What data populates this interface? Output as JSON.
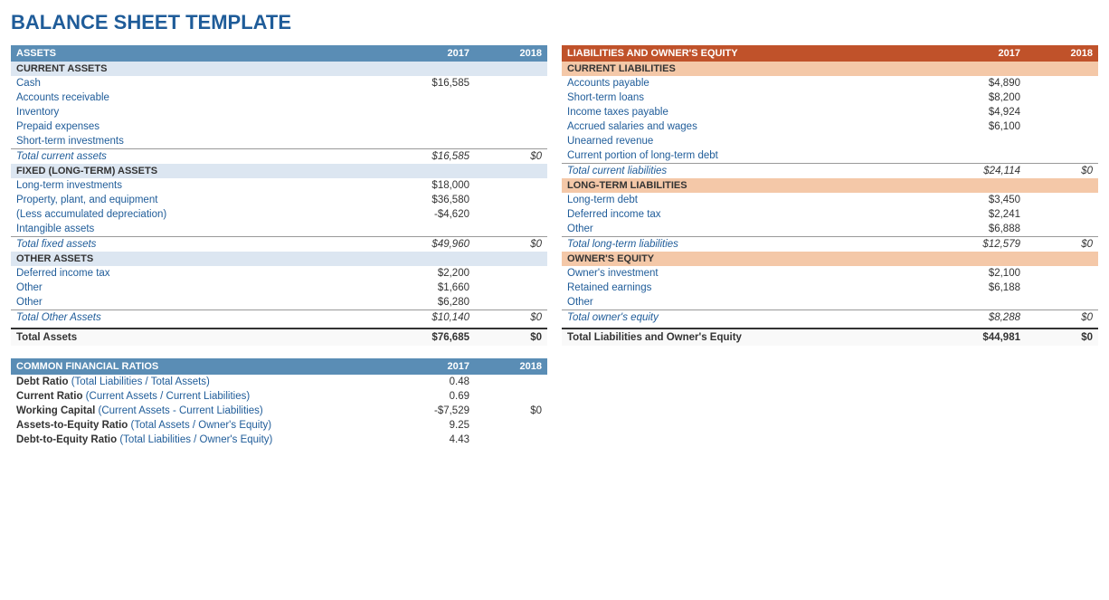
{
  "title": "BALANCE SHEET TEMPLATE",
  "colors": {
    "blue_header": "#5a8db5",
    "orange_header": "#c0522a",
    "blue_sub": "#dce6f1",
    "orange_sub": "#f4c8a8",
    "blue_text": "#1f5c99",
    "title_blue": "#1f5c99"
  },
  "assets": {
    "header": "ASSETS",
    "col2017": "2017",
    "col2018": "2018",
    "current_assets": {
      "label": "CURRENT ASSETS",
      "rows": [
        {
          "label": "Cash",
          "v2017": "$16,585",
          "v2018": ""
        },
        {
          "label": "Accounts receivable",
          "v2017": "",
          "v2018": ""
        },
        {
          "label": "Inventory",
          "v2017": "",
          "v2018": ""
        },
        {
          "label": "Prepaid expenses",
          "v2017": "",
          "v2018": ""
        },
        {
          "label": "Short-term investments",
          "v2017": "",
          "v2018": ""
        }
      ],
      "total_label": "Total current assets",
      "total2017": "$16,585",
      "total2018": "$0"
    },
    "fixed_assets": {
      "label": "FIXED (LONG-TERM) ASSETS",
      "rows": [
        {
          "label": "Long-term investments",
          "v2017": "$18,000",
          "v2018": ""
        },
        {
          "label": "Property, plant, and equipment",
          "v2017": "$36,580",
          "v2018": ""
        },
        {
          "label": "(Less accumulated depreciation)",
          "v2017": "-$4,620",
          "v2018": ""
        },
        {
          "label": "Intangible assets",
          "v2017": "",
          "v2018": ""
        }
      ],
      "total_label": "Total fixed assets",
      "total2017": "$49,960",
      "total2018": "$0"
    },
    "other_assets": {
      "label": "OTHER ASSETS",
      "rows": [
        {
          "label": "Deferred income tax",
          "v2017": "$2,200",
          "v2018": ""
        },
        {
          "label": "Other",
          "v2017": "$1,660",
          "v2018": ""
        },
        {
          "label": "Other",
          "v2017": "$6,280",
          "v2018": ""
        }
      ],
      "total_label": "Total Other Assets",
      "total2017": "$10,140",
      "total2018": "$0"
    },
    "total_label": "Total Assets",
    "total2017": "$76,685",
    "total2018": "$0"
  },
  "liabilities": {
    "header": "LIABILITIES AND OWNER'S EQUITY",
    "col2017": "2017",
    "col2018": "2018",
    "current_liabilities": {
      "label": "CURRENT LIABILITIES",
      "rows": [
        {
          "label": "Accounts payable",
          "v2017": "$4,890",
          "v2018": ""
        },
        {
          "label": "Short-term loans",
          "v2017": "$8,200",
          "v2018": ""
        },
        {
          "label": "Income taxes payable",
          "v2017": "$4,924",
          "v2018": ""
        },
        {
          "label": "Accrued salaries and wages",
          "v2017": "$6,100",
          "v2018": ""
        },
        {
          "label": "Unearned revenue",
          "v2017": "",
          "v2018": ""
        },
        {
          "label": "Current portion of long-term debt",
          "v2017": "",
          "v2018": ""
        }
      ],
      "total_label": "Total current liabilities",
      "total2017": "$24,114",
      "total2018": "$0"
    },
    "long_term_liabilities": {
      "label": "LONG-TERM LIABILITIES",
      "rows": [
        {
          "label": "Long-term debt",
          "v2017": "$3,450",
          "v2018": ""
        },
        {
          "label": "Deferred income tax",
          "v2017": "$2,241",
          "v2018": ""
        },
        {
          "label": "Other",
          "v2017": "$6,888",
          "v2018": ""
        }
      ],
      "total_label": "Total long-term liabilities",
      "total2017": "$12,579",
      "total2018": "$0"
    },
    "owners_equity": {
      "label": "OWNER'S EQUITY",
      "rows": [
        {
          "label": "Owner's investment",
          "v2017": "$2,100",
          "v2018": ""
        },
        {
          "label": "Retained earnings",
          "v2017": "$6,188",
          "v2018": ""
        },
        {
          "label": "Other",
          "v2017": "",
          "v2018": ""
        }
      ],
      "total_label": "Total owner's equity",
      "total2017": "$8,288",
      "total2018": "$0"
    },
    "total_label": "Total Liabilities and Owner's Equity",
    "total2017": "$44,981",
    "total2018": "$0"
  },
  "ratios": {
    "header": "COMMON FINANCIAL RATIOS",
    "col2017": "2017",
    "col2018": "2018",
    "rows": [
      {
        "bold": "Debt Ratio",
        "normal": " (Total Liabilities / Total Assets)",
        "v2017": "0.48",
        "v2018": ""
      },
      {
        "bold": "Current Ratio",
        "normal": " (Current Assets / Current Liabilities)",
        "v2017": "0.69",
        "v2018": ""
      },
      {
        "bold": "Working Capital",
        "normal": " (Current Assets - Current Liabilities)",
        "v2017": "-$7,529",
        "v2018": "$0"
      },
      {
        "bold": "Assets-to-Equity Ratio",
        "normal": " (Total Assets / Owner's Equity)",
        "v2017": "9.25",
        "v2018": ""
      },
      {
        "bold": "Debt-to-Equity Ratio",
        "normal": " (Total Liabilities / Owner's Equity)",
        "v2017": "4.43",
        "v2018": ""
      }
    ]
  }
}
